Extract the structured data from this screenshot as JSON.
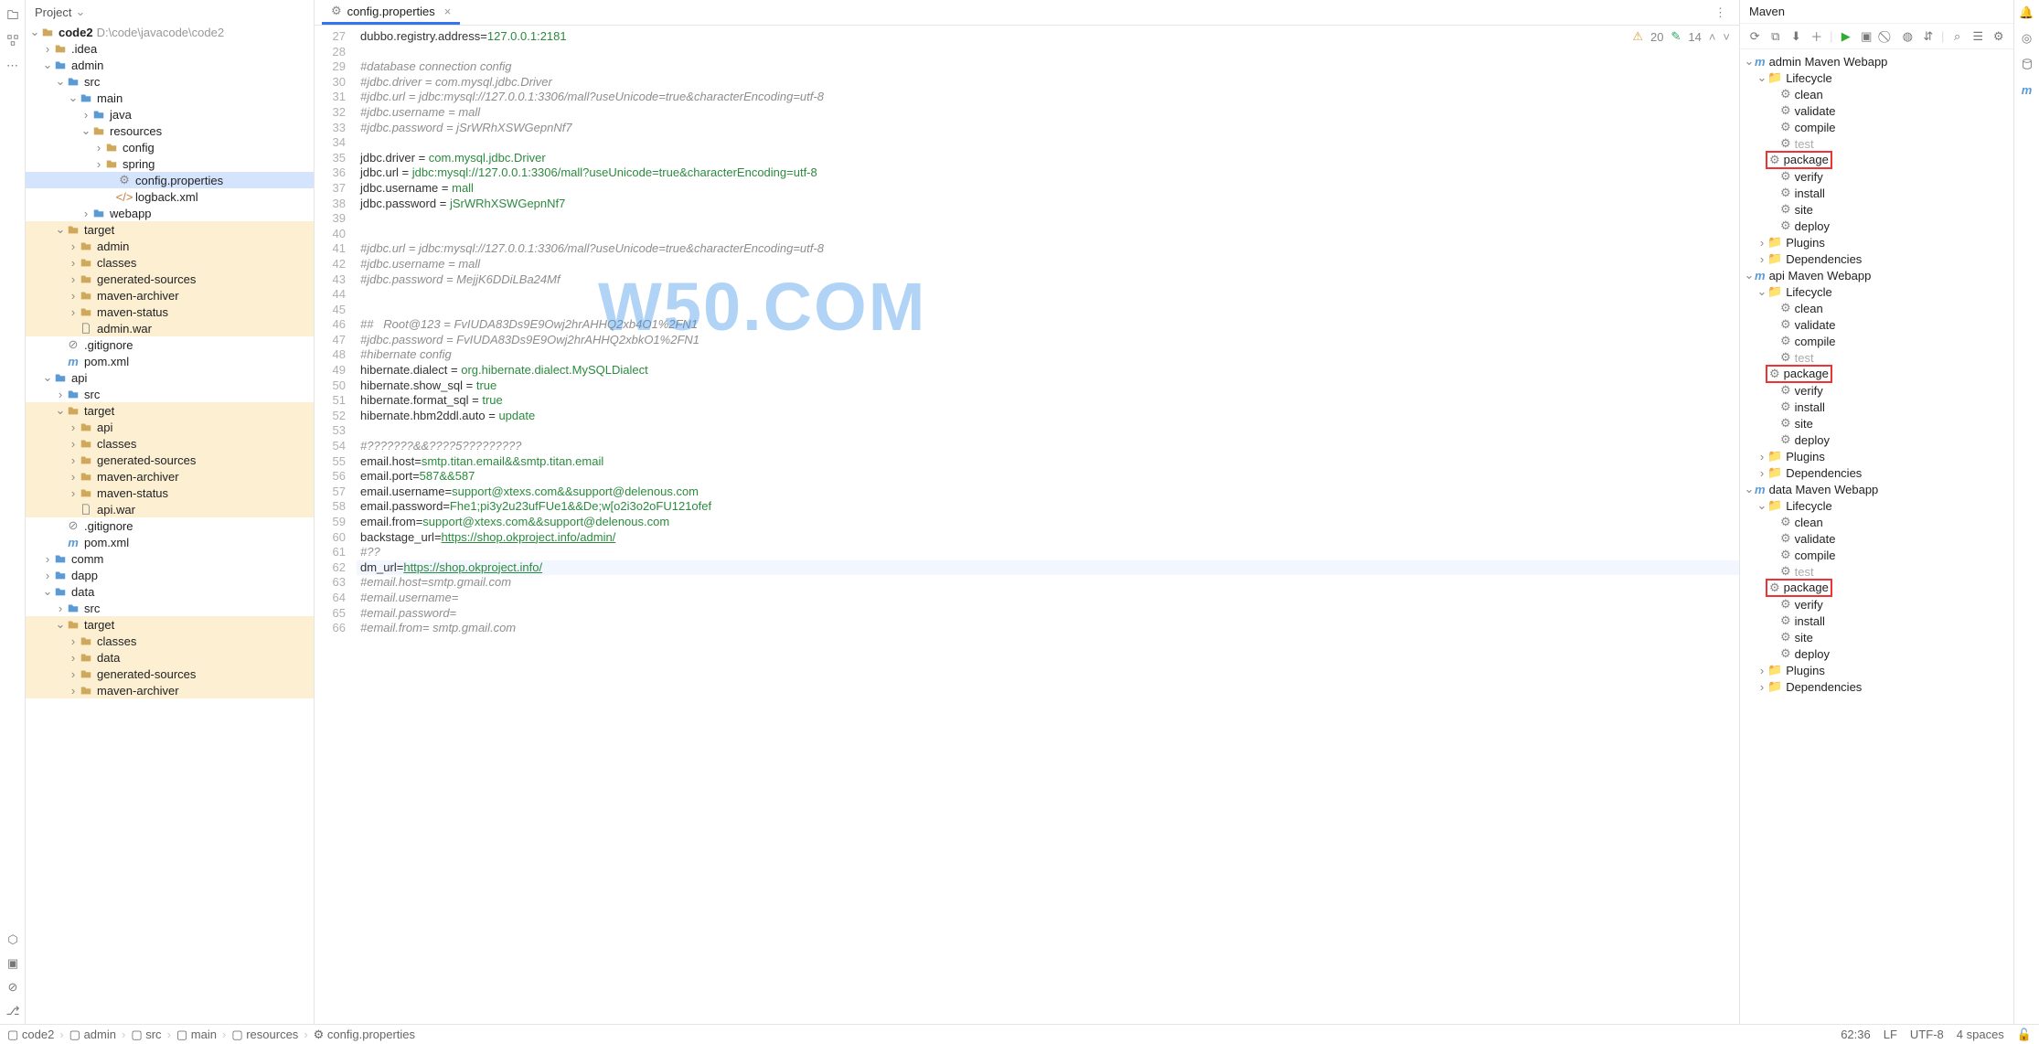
{
  "project_panel_title": "Project",
  "tree": {
    "root": {
      "name": "code2",
      "suffix": "D:\\code\\javacode\\code2"
    },
    "idea": ".idea",
    "admin": "admin",
    "src": "src",
    "main": "main",
    "java": "java",
    "resources": "resources",
    "config": "config",
    "spring": "spring",
    "config_properties": "config.properties",
    "logback": "logback.xml",
    "webapp": "webapp",
    "target": "target",
    "admin_node": "admin",
    "classes": "classes",
    "generated_sources": "generated-sources",
    "maven_archiver": "maven-archiver",
    "maven_status": "maven-status",
    "admin_war": "admin.war",
    "gitignore": ".gitignore",
    "pom": "pom.xml",
    "api": "api",
    "api_node": "api",
    "api_war": "api.war",
    "comm": "comm",
    "dapp": "dapp",
    "data": "data",
    "data_node": "data"
  },
  "tab": {
    "label": "config.properties"
  },
  "editor_lines": [
    {
      "n": 27,
      "html": "<span class='key'>dubbo.registry.address</span>=<span class='val'>127.0.0.1:2181</span>"
    },
    {
      "n": 28,
      "html": ""
    },
    {
      "n": 29,
      "html": "<span class='cmt'>#database connection config</span>"
    },
    {
      "n": 30,
      "html": "<span class='cmt'>#jdbc.driver = com.mysql.jdbc.Driver</span>"
    },
    {
      "n": 31,
      "html": "<span class='cmt'>#jdbc.url = jdbc:mysql://127.0.0.1:3306/mall?useUnicode=true&amp;characterEncoding=utf-8</span>"
    },
    {
      "n": 32,
      "html": "<span class='cmt'>#jdbc.username = mall</span>"
    },
    {
      "n": 33,
      "html": "<span class='cmt'>#jdbc.password = jSrWRhXSWGepnNf7</span>"
    },
    {
      "n": 34,
      "html": ""
    },
    {
      "n": 35,
      "html": "<span class='key'>jdbc.driver</span> = <span class='val'>com.mysql.jdbc.Driver</span>"
    },
    {
      "n": 36,
      "html": "<span class='key'>jdbc.url</span> = <span class='val'>jdbc:mysql://127.0.0.1:3306/mall?useUnicode=true&amp;characterEncoding=utf-8</span>"
    },
    {
      "n": 37,
      "html": "<span class='key'>jdbc.username</span> = <span class='val'>mall</span>"
    },
    {
      "n": 38,
      "html": "<span class='key'>jdbc.password</span> = <span class='val'>jSrWRhXSWGepnNf7</span>"
    },
    {
      "n": 39,
      "html": ""
    },
    {
      "n": 40,
      "html": ""
    },
    {
      "n": 41,
      "html": "<span class='cmt'>#jdbc.url = jdbc:mysql://127.0.0.1:3306/mall?useUnicode=true&amp;characterEncoding=utf-8</span>"
    },
    {
      "n": 42,
      "html": "<span class='cmt'>#jdbc.username = mall</span>"
    },
    {
      "n": 43,
      "html": "<span class='cmt'>#jdbc.password = MejjK6DDiLBa24Mf</span>"
    },
    {
      "n": 44,
      "html": ""
    },
    {
      "n": 45,
      "html": ""
    },
    {
      "n": 46,
      "html": "<span class='cmt'>##   Root@123 = FvIUDA83Ds9E9Owj2hrAHHQ2xb4O1%2FN1</span>"
    },
    {
      "n": 47,
      "html": "<span class='cmt'>#jdbc.password = FvIUDA83Ds9E9Owj2hrAHHQ2xbkO1%2FN1</span>"
    },
    {
      "n": 48,
      "html": "<span class='cmt'>#hibernate config</span>"
    },
    {
      "n": 49,
      "html": "<span class='key'>hibernate.dialect</span> = <span class='val'>org.hibernate.dialect.MySQLDialect</span>"
    },
    {
      "n": 50,
      "html": "<span class='key'>hibernate.show_sql</span> = <span class='val'>true</span>"
    },
    {
      "n": 51,
      "html": "<span class='key'>hibernate.format_sql</span> = <span class='val'>true</span>"
    },
    {
      "n": 52,
      "html": "<span class='key'>hibernate.hbm2ddl.auto</span> = <span class='val'>update</span>"
    },
    {
      "n": 53,
      "html": ""
    },
    {
      "n": 54,
      "html": "<span class='cmt'>#???????&amp;&amp;????5?????????</span>"
    },
    {
      "n": 55,
      "html": "<span class='key'>email.host</span>=<span class='val'>smtp.titan.email&amp;&amp;smtp.titan.email</span>"
    },
    {
      "n": 56,
      "html": "<span class='key'>email.port</span>=<span class='val'>587&amp;&amp;587</span>"
    },
    {
      "n": 57,
      "html": "<span class='key'>email.username</span>=<span class='val'>support@xtexs.com&amp;&amp;support@delenous.com</span>"
    },
    {
      "n": 58,
      "html": "<span class='key'>email.password</span>=<span class='val'>Fhe1;pi3y2u23ufFUe1&amp;&amp;De;w[o2i3o2oFU121ofef</span>"
    },
    {
      "n": 59,
      "html": "<span class='key'>email.from</span>=<span class='val'>support@xtexs.com&amp;&amp;support@delenous.com</span>"
    },
    {
      "n": 60,
      "html": "<span class='key'>backstage_url</span>=<span class='str'>https://shop.okproject.info/admin/</span>"
    },
    {
      "n": 61,
      "html": "<span class='cmt'>#??</span>"
    },
    {
      "n": 62,
      "html": "<span class='key'>dm_url</span>=<span class='str'>https://shop.okproject.info/</span>",
      "cur": true
    },
    {
      "n": 63,
      "html": "<span class='cmt'>#email.host=smtp.gmail.com</span>"
    },
    {
      "n": 64,
      "html": "<span class='cmt'>#email.username=</span>"
    },
    {
      "n": 65,
      "html": "<span class='cmt'>#email.password=</span>"
    },
    {
      "n": 66,
      "html": "<span class='cmt'>#email.from= smtp.gmail.com</span>"
    }
  ],
  "warnings": {
    "warn": "20",
    "typo": "14"
  },
  "watermark": "W50.COM",
  "maven": {
    "title": "Maven",
    "modules": [
      {
        "name": "admin Maven Webapp",
        "box": true
      },
      {
        "name": "api Maven Webapp",
        "box": false
      },
      {
        "name": "data Maven Webapp",
        "box": false
      }
    ],
    "lifecycle_label": "Lifecycle",
    "plugins_label": "Plugins",
    "dependencies_label": "Dependencies",
    "phases": [
      "clean",
      "validate",
      "compile",
      "test",
      "package",
      "verify",
      "install",
      "site",
      "deploy"
    ]
  },
  "breadcrumb": [
    "code2",
    "admin",
    "src",
    "main",
    "resources",
    "config.properties"
  ],
  "status": {
    "pos": "62:36",
    "lf": "LF",
    "enc": "UTF-8",
    "indent": "4 spaces"
  }
}
